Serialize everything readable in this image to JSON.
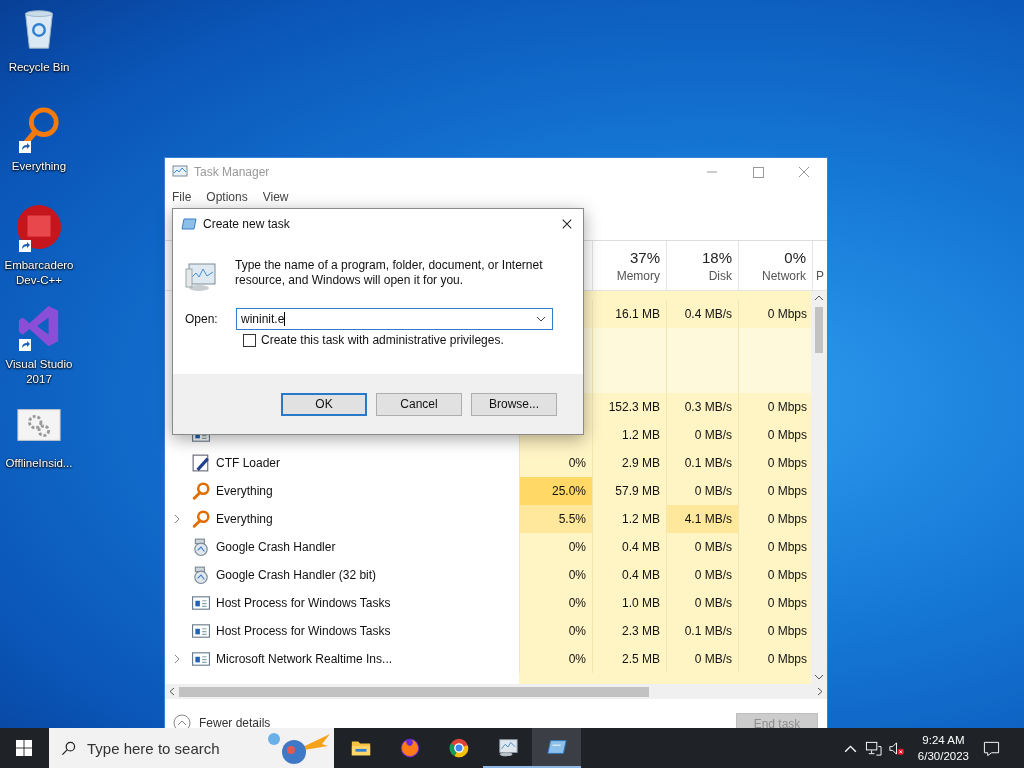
{
  "desktop_icons": [
    {
      "label": "Recycle Bin",
      "kind": "recycle-bin",
      "shortcut": false
    },
    {
      "label": "Everything",
      "kind": "magnifier",
      "shortcut": true
    },
    {
      "label": "Embarcadero Dev-C++",
      "kind": "dev-cpp",
      "shortcut": true
    },
    {
      "label": "Visual Studio 2017",
      "kind": "visual-studio",
      "shortcut": true
    },
    {
      "label": "OfflineInsid...",
      "kind": "settings-file",
      "shortcut": false
    }
  ],
  "task_manager": {
    "title": "Task Manager",
    "menu": [
      "File",
      "Options",
      "View"
    ],
    "columns": [
      {
        "percent": "37%",
        "label": "Memory"
      },
      {
        "percent": "18%",
        "label": "Disk"
      },
      {
        "percent": "0%",
        "label": "Network"
      },
      {
        "label": "P"
      }
    ],
    "rows": [
      {
        "kind": "covered",
        "memory": "16.1 MB",
        "disk": {
          "text": "0.4 MB/s",
          "color": "#fff4c4"
        },
        "network": "0 Mbps"
      },
      {
        "kind": "group"
      },
      {
        "kind": "covered",
        "memory": "152.3 MB",
        "disk": {
          "text": "0.3 MB/s",
          "color": "#fff4c4"
        },
        "network": "0 Mbps"
      },
      {
        "kind": "window",
        "expandable": false,
        "memory": "1.2 MB",
        "disk": {
          "text": "0 MB/s",
          "color": "#fff4c4"
        },
        "network": "0 Mbps"
      },
      {
        "kind": "pen",
        "expandable": false,
        "name": "CTF Loader",
        "cpu": {
          "text": "0%",
          "color": "#fff4c4"
        },
        "memory": "2.9 MB",
        "disk": {
          "text": "0.1 MB/s",
          "color": "#fff4c4"
        },
        "network": "0 Mbps"
      },
      {
        "kind": "magnifier",
        "expandable": false,
        "name": "Everything",
        "cpu": {
          "text": "25.0%",
          "color": "#ffd865"
        },
        "memory": "57.9 MB",
        "disk": {
          "text": "0 MB/s",
          "color": "#fff4c4"
        },
        "network": "0 Mbps"
      },
      {
        "kind": "magnifier",
        "expandable": true,
        "name": "Everything",
        "cpu": {
          "text": "5.5%",
          "color": "#ffe79c"
        },
        "memory": "1.2 MB",
        "disk": {
          "text": "4.1 MB/s",
          "color": "#ffe79c"
        },
        "network": "0 Mbps"
      },
      {
        "kind": "crash",
        "expandable": false,
        "name": "Google Crash Handler",
        "cpu": {
          "text": "0%",
          "color": "#fff4c4"
        },
        "memory": "0.4 MB",
        "disk": {
          "text": "0 MB/s",
          "color": "#fff4c4"
        },
        "network": "0 Mbps"
      },
      {
        "kind": "crash",
        "expandable": false,
        "name": "Google Crash Handler (32 bit)",
        "cpu": {
          "text": "0%",
          "color": "#fff4c4"
        },
        "memory": "0.4 MB",
        "disk": {
          "text": "0 MB/s",
          "color": "#fff4c4"
        },
        "network": "0 Mbps"
      },
      {
        "kind": "window",
        "expandable": false,
        "name": "Host Process for Windows Tasks",
        "cpu": {
          "text": "0%",
          "color": "#fff4c4"
        },
        "memory": "1.0 MB",
        "disk": {
          "text": "0 MB/s",
          "color": "#fff4c4"
        },
        "network": "0 Mbps"
      },
      {
        "kind": "window",
        "expandable": false,
        "name": "Host Process for Windows Tasks",
        "cpu": {
          "text": "0%",
          "color": "#fff4c4"
        },
        "memory": "2.3 MB",
        "disk": {
          "text": "0.1 MB/s",
          "color": "#fff4c4"
        },
        "network": "0 Mbps"
      },
      {
        "kind": "window",
        "expandable": true,
        "name": "Microsoft Network Realtime Ins...",
        "cpu": {
          "text": "0%",
          "color": "#fff4c4"
        },
        "memory": "2.5 MB",
        "disk": {
          "text": "0 MB/s",
          "color": "#fff4c4"
        },
        "network": "0 Mbps"
      }
    ],
    "fewer_details": "Fewer details",
    "end_task": {
      "label": "End task",
      "disabled": true
    }
  },
  "dialog": {
    "title": "Create new task",
    "message": "Type the name of a program, folder, document, or Internet resource, and Windows will open it for you.",
    "open_label": "Open:",
    "open_value": "wininit.e",
    "admin_checkbox": {
      "label": "Create this task with administrative privileges.",
      "checked": false
    },
    "buttons": [
      {
        "label": "OK",
        "default": true
      },
      {
        "label": "Cancel",
        "default": false
      },
      {
        "label": "Browse...",
        "default": false
      }
    ]
  },
  "taskbar": {
    "search_placeholder": "Type here to search",
    "pinned": [
      {
        "kind": "folder",
        "running": false,
        "selected": false
      },
      {
        "kind": "fire-browser",
        "running": false,
        "selected": false
      },
      {
        "kind": "ring-browser",
        "running": false,
        "selected": false
      },
      {
        "kind": "monitor",
        "running": true,
        "selected": false
      },
      {
        "kind": "run-dialog",
        "running": true,
        "selected": true
      }
    ],
    "volume_muted": true,
    "time": "9:24 AM",
    "date": "6/30/2023"
  }
}
